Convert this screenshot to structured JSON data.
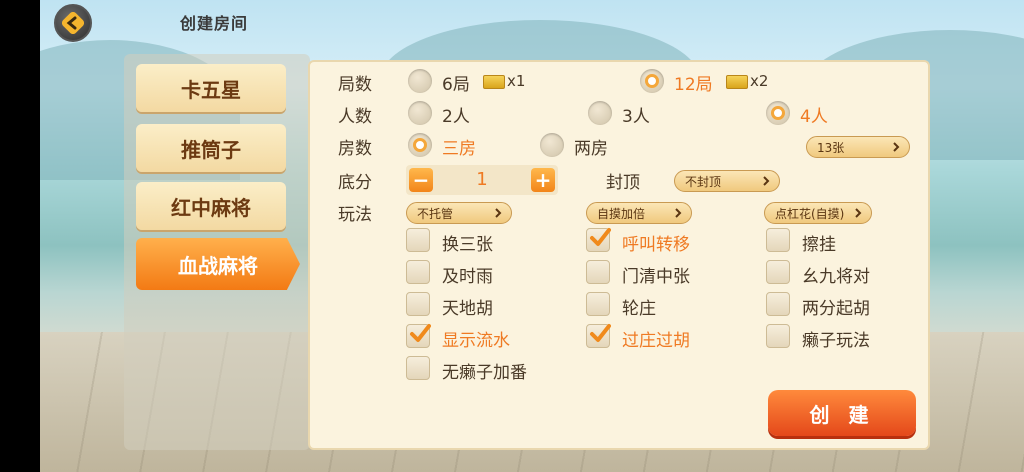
{
  "header": {
    "title": "创建房间"
  },
  "nav": [
    {
      "label": "卡五星",
      "active": false
    },
    {
      "label": "推筒子",
      "active": false
    },
    {
      "label": "红中麻将",
      "active": false
    },
    {
      "label": "血战麻将",
      "active": true
    }
  ],
  "rows": {
    "rounds": {
      "label": "局数",
      "options": [
        {
          "label": "6局",
          "mult": "x1",
          "selected": false
        },
        {
          "label": "12局",
          "mult": "x2",
          "selected": true
        }
      ]
    },
    "players": {
      "label": "人数",
      "options": [
        {
          "label": "2人",
          "selected": false
        },
        {
          "label": "3人",
          "selected": false
        },
        {
          "label": "4人",
          "selected": true
        }
      ]
    },
    "rooms": {
      "label": "房数",
      "options": [
        {
          "label": "三房",
          "selected": true
        },
        {
          "label": "两房",
          "selected": false
        }
      ],
      "tiles_dropdown": "13张"
    },
    "base": {
      "label": "底分",
      "value": "1",
      "cap_label": "封顶",
      "cap_dropdown": "不封顶"
    },
    "rules": {
      "label": "玩法",
      "dropdowns": [
        "不托管",
        "自摸加倍",
        "点杠花(自摸)"
      ]
    }
  },
  "options": [
    {
      "label": "换三张",
      "checked": false
    },
    {
      "label": "呼叫转移",
      "checked": true
    },
    {
      "label": "擦挂",
      "checked": false
    },
    {
      "label": "及时雨",
      "checked": false
    },
    {
      "label": "门清中张",
      "checked": false
    },
    {
      "label": "幺九将对",
      "checked": false
    },
    {
      "label": "天地胡",
      "checked": false
    },
    {
      "label": "轮庄",
      "checked": false
    },
    {
      "label": "两分起胡",
      "checked": false
    },
    {
      "label": "显示流水",
      "checked": true
    },
    {
      "label": "过庄过胡",
      "checked": true
    },
    {
      "label": "癞子玩法",
      "checked": false
    },
    {
      "label": "无癞子加番",
      "checked": false
    }
  ],
  "create_button": "创 建",
  "colors": {
    "accent": "#ef7a23",
    "text": "#4a3a28",
    "panel": "#fbf3de"
  }
}
